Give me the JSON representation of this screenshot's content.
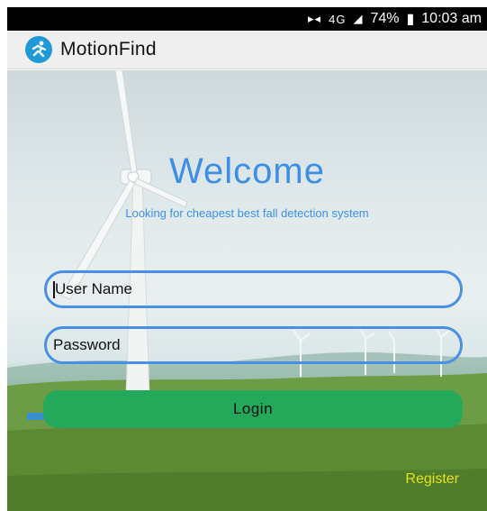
{
  "status_bar": {
    "network": "4G",
    "battery": "74%",
    "time": "10:03 am"
  },
  "app_bar": {
    "title": "MotionFind",
    "logo_icon": "running-person-icon"
  },
  "hero": {
    "welcome": "Welcome",
    "tagline": "Looking for cheapest best fall detection system"
  },
  "form": {
    "username_placeholder": "User Name",
    "password_placeholder": "Password",
    "login_label": "Login",
    "register_label": "Register"
  },
  "colors": {
    "accent_blue": "#3d8fe6",
    "login_green": "#24a85a",
    "register_yellow": "#e4e01c"
  }
}
